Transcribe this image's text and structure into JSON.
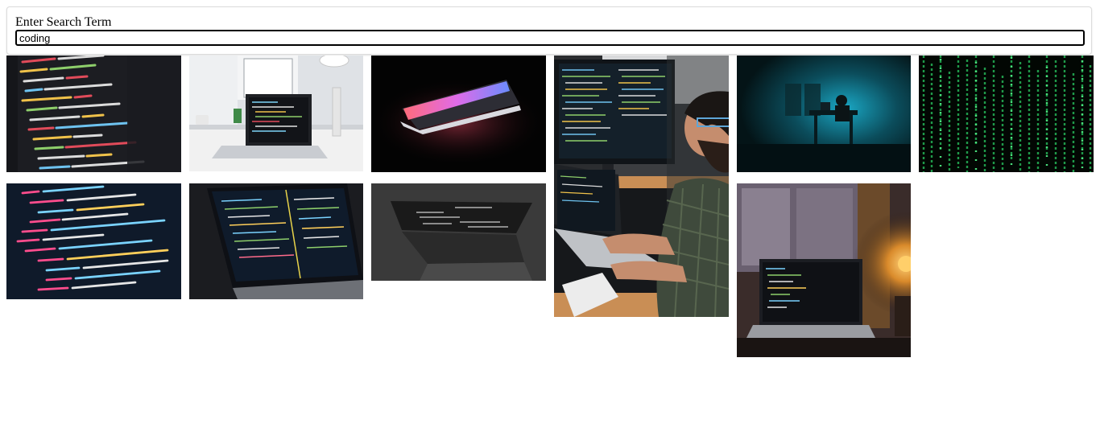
{
  "search": {
    "label": "Enter Search Term",
    "value": "coding"
  },
  "results": [
    {
      "name": "code-editor-closeup-image"
    },
    {
      "name": "laptop-on-desk-image"
    },
    {
      "name": "glowing-laptop-dark-image"
    },
    {
      "name": "developer-at-monitors-image"
    },
    {
      "name": "hacker-dark-room-image"
    },
    {
      "name": "matrix-green-code-image"
    },
    {
      "name": "html-svg-code-image"
    },
    {
      "name": "laptop-code-dark-image"
    },
    {
      "name": "monochrome-laptop-image"
    },
    {
      "name": "laptop-by-window-lamp-image"
    }
  ]
}
